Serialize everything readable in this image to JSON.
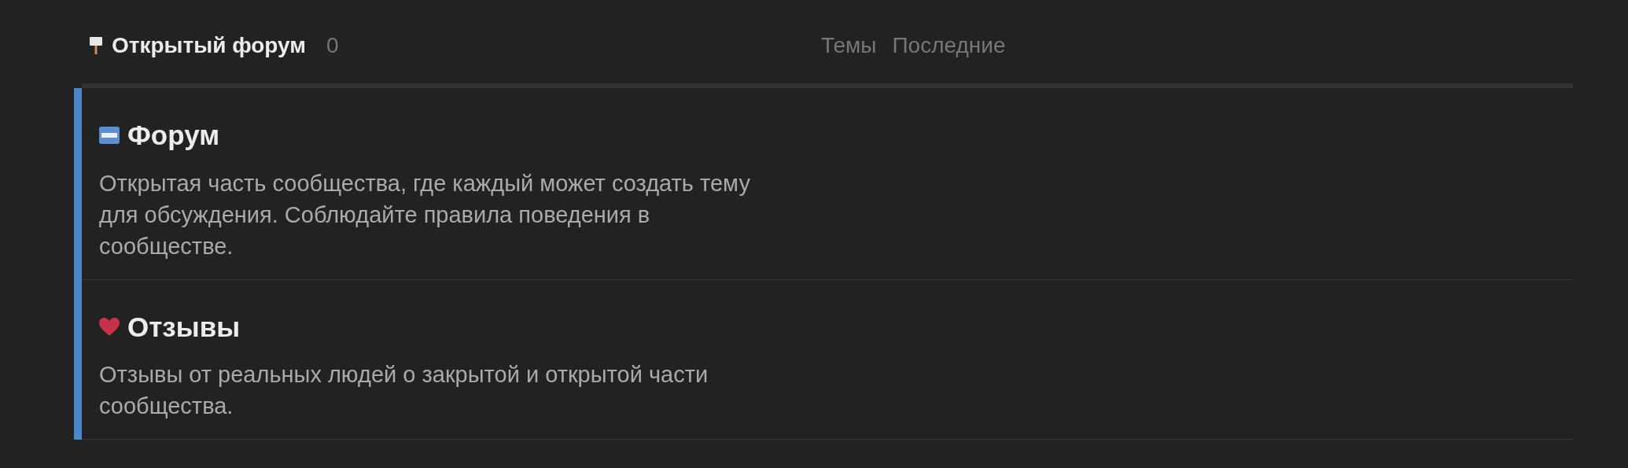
{
  "section": {
    "title": "Открытый форум",
    "count": "0"
  },
  "tabs": [
    {
      "label": "Темы",
      "selected": false
    },
    {
      "label": "Последние",
      "selected": false
    }
  ],
  "categories": [
    {
      "kind": "free",
      "title": "Форум",
      "description": "Открытая часть сообщества, где каждый может создать тему для обсуждения. Соблюдайте правила поведения в сообществе."
    },
    {
      "kind": "heart",
      "title": "Отзывы",
      "description": "Отзывы от реальных людей о закрытой и открытой части сообщества."
    }
  ]
}
